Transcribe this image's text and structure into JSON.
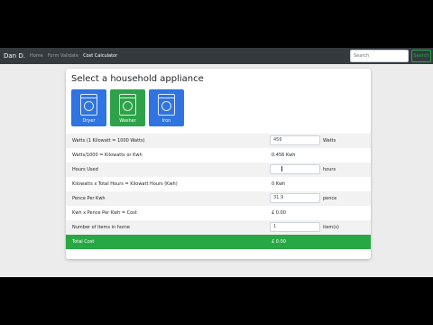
{
  "navbar": {
    "brand": "Dan D.",
    "links": [
      "Home",
      "Form Validate",
      "Cost Calculator"
    ],
    "search_placeholder": "Search",
    "search_button": "Search"
  },
  "card": {
    "title": "Select a household appliance",
    "appliances": [
      {
        "label": "Dryer",
        "color": "#2f74e0"
      },
      {
        "label": "Washer",
        "color": "#2ea24a"
      },
      {
        "label": "Iron",
        "color": "#2f74e0"
      }
    ],
    "rows": [
      {
        "label": "Watts (1 Kilowatt = 1000 Watts)",
        "value": "456",
        "unit": "Watts"
      },
      {
        "label": "Watts/1000 = Kilowatts or Kwh",
        "value": "0.456 Kwh"
      },
      {
        "label": "Hours Used",
        "value": "",
        "unit": "hours"
      },
      {
        "label": "Kilowatts x Total Hours = Kilowatt Hours (Kwh)",
        "value": "0 Kwh"
      },
      {
        "label": "Pence Per Kwh",
        "value": "31.9",
        "unit": "pence"
      },
      {
        "label": "Kwh x Pence Per Kwh = Cost",
        "value": "£ 0.00"
      },
      {
        "label": "Number of items in home",
        "value": "1",
        "unit": "item(s)"
      }
    ],
    "total": {
      "label": "Total Cost",
      "value": "£ 0.00"
    }
  },
  "colors": {
    "navbar": "#343a40",
    "success": "#28a745",
    "primary": "#2f74e0"
  }
}
